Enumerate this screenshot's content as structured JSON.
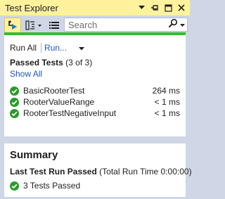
{
  "window": {
    "title": "Test Explorer"
  },
  "toolbar": {
    "search_placeholder": "Search"
  },
  "run_bar": {
    "run_all": "Run All",
    "run_menu": "Run..."
  },
  "group": {
    "name": "Passed Tests",
    "count": "(3 of 3)",
    "show_all": "Show All"
  },
  "tests": [
    {
      "name": "BasicRooterTest",
      "duration": "264 ms",
      "status": "passed"
    },
    {
      "name": "RooterValueRange",
      "duration": "< 1 ms",
      "status": "passed"
    },
    {
      "name": "RooterTestNegativeInput",
      "duration": "< 1 ms",
      "status": "passed"
    }
  ],
  "summary": {
    "title": "Summary",
    "last_run_label": "Last Test Run Passed",
    "total_time": "(Total Run Time 0:00:00)",
    "passed_count": "3 Tests Passed"
  },
  "colors": {
    "accent": "#fff29d",
    "chrome": "#cfd6e5",
    "progress": "#2ebf2e",
    "pass": "#2a9a2a",
    "link": "#1b55c8"
  }
}
